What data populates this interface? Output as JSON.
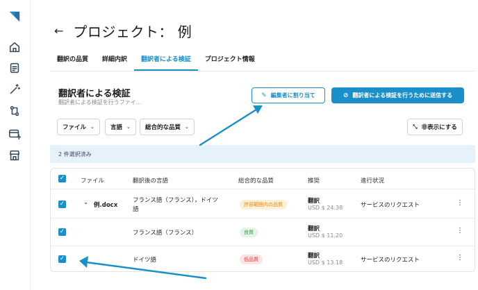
{
  "sidebar": {
    "logo": "logo-icon",
    "items": [
      {
        "name": "home-icon"
      },
      {
        "name": "document-icon"
      },
      {
        "name": "magic-wand-icon"
      },
      {
        "name": "workflow-icon"
      },
      {
        "name": "card-plus-icon"
      },
      {
        "name": "store-icon"
      }
    ]
  },
  "header": {
    "back_icon": "←",
    "title": "プロジェクト： 例"
  },
  "tabs": [
    {
      "label": "翻訳の品質",
      "active": false
    },
    {
      "label": "詳細内訳",
      "active": false
    },
    {
      "label": "翻訳者による検証",
      "active": true
    },
    {
      "label": "プロジェクト情報",
      "active": false
    }
  ],
  "section": {
    "title": "翻訳者による検証",
    "subtitle": "翻訳者による検証を行うファイ..."
  },
  "actions": {
    "assign_editor_label": "編集者に割り当て",
    "assign_editor_icon": "✎",
    "send_label": "翻訳者による検証を行うために送信する",
    "send_icon": "⊘"
  },
  "filters": {
    "file_label": "ファイル",
    "language_label": "言語",
    "quality_label": "総合的な品質",
    "chevron": "⌄",
    "hide_label": "非表示にする",
    "hide_icon": "⤡"
  },
  "selection": {
    "text": "2 件選択済み"
  },
  "table": {
    "headers": {
      "file": "ファイル",
      "target_language": "翻訳後の言語",
      "overall_quality": "総合的な品質",
      "recommendation": "推奨",
      "progress": "進行状況"
    },
    "rows": [
      {
        "file": "例.docx",
        "expand_icon": "⌄",
        "language_line1": "フランス語（フランス），ドイツ",
        "language_line2": "語",
        "quality": "許容範囲内の品質",
        "quality_level": "warn",
        "recommendation": "翻訳",
        "price": "USD $ 24.38",
        "progress": "サービスのリクエスト",
        "checked": true
      },
      {
        "file": "",
        "language_line1": "フランス語（フランス）",
        "quality": "良質",
        "quality_level": "good",
        "recommendation": "翻訳",
        "price": "USD $ 11.20",
        "progress": "",
        "checked": true
      },
      {
        "file": "",
        "language_line1": "ドイツ語",
        "quality": "低品質",
        "quality_level": "bad",
        "recommendation": "翻訳",
        "price": "USD $ 13.18",
        "progress": "サービスのリクエスト",
        "checked": true
      }
    ],
    "kebab": "⋮",
    "check_mark": "✓"
  },
  "colors": {
    "accent": "#1a8fc9",
    "selection_bg": "#e6f2fb",
    "annotation_arrow": "#1a8fc9"
  }
}
